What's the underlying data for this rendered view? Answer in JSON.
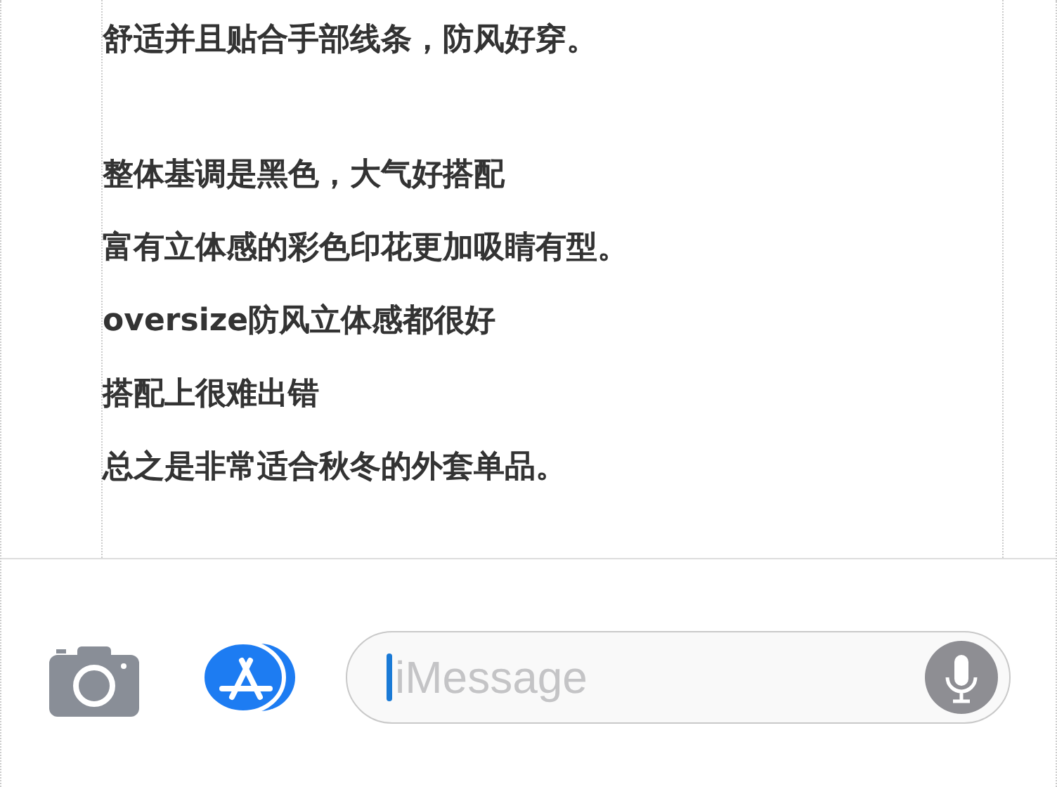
{
  "article": {
    "groups": [
      [
        "舒适并且贴合手部线条，防风好穿。"
      ],
      [
        "整体基调是黑色，大气好搭配",
        "富有立体感的彩色印花更加吸睛有型。",
        "oversize防风立体感都很好",
        "搭配上很难出错",
        "总之是非常适合秋冬的外套单品。"
      ]
    ]
  },
  "compose": {
    "placeholder": "iMessage"
  }
}
